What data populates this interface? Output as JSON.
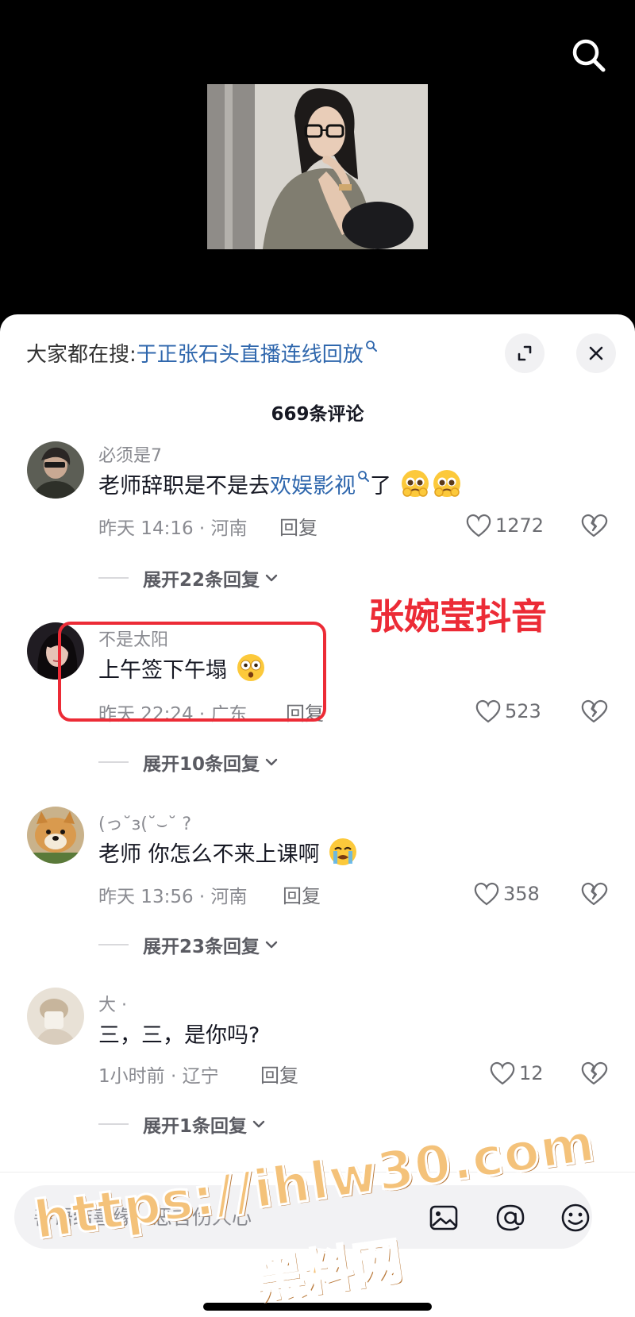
{
  "trending": {
    "prefix": "大家都在搜:",
    "query": "于正张石头直播连线回放"
  },
  "comment_count_title": "669条评论",
  "comments": [
    {
      "username": "必须是7",
      "text_before": "老师辞职是不是去",
      "text_link": "欢娱影视",
      "text_after": "了",
      "emojis": [
        "pleading-face-emoji",
        "pleading-face-emoji"
      ],
      "time_location": "昨天 14:16 · 河南",
      "reply_label": "回复",
      "likes": "1272",
      "expand_replies": "展开22条回复"
    },
    {
      "username": "不是太阳",
      "text": "上午签下午塌",
      "emojis": [
        "flushed-face-emoji"
      ],
      "time_location": "昨天 22:24 · 广东",
      "reply_label": "回复",
      "likes": "523",
      "expand_replies": "展开10条回复"
    },
    {
      "username": "(っ˘з(˘⌣˘ ?",
      "text": "老师 你怎么不来上课啊",
      "emojis": [
        "crying-face-emoji"
      ],
      "time_location": "昨天 13:56 · 河南",
      "reply_label": "回复",
      "likes": "358",
      "expand_replies": "展开23条回复"
    },
    {
      "username": "大 ·",
      "text": "三，三，是你吗?",
      "time_location": "1小时前 · 辽宁",
      "reply_label": "回复",
      "likes": "12",
      "expand_replies": "展开1条回复"
    }
  ],
  "annotation": "张婉莹抖音",
  "input": {
    "placeholder": "善语结善缘，恶言伤人心"
  },
  "watermark": {
    "line1": "https://ihlw30.com",
    "line2": "黑料网"
  },
  "colors": {
    "accent_link": "#2f67ad",
    "highlight_red": "#ec2b36",
    "secondary_text": "#8a8b91"
  }
}
